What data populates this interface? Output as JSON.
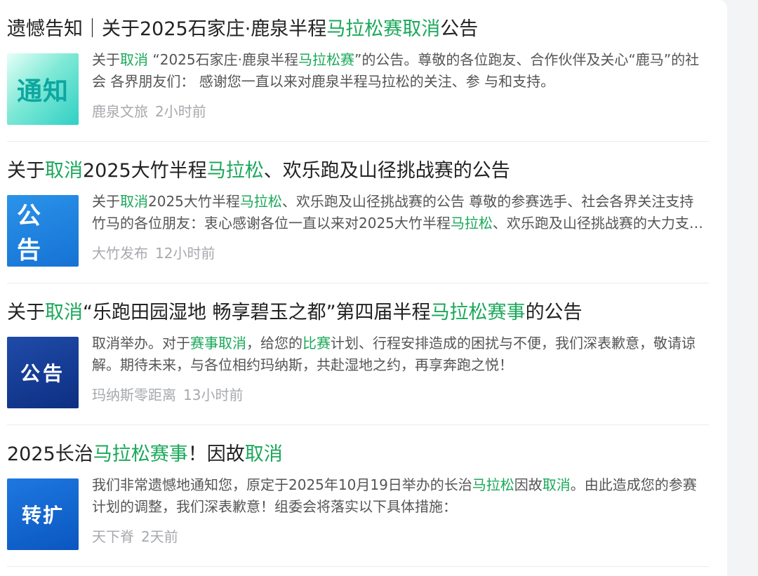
{
  "results": [
    {
      "title": [
        {
          "t": "遗憾告知｜关于2025石家庄·鹿泉半程",
          "hl": false
        },
        {
          "t": "马拉松赛取消",
          "hl": true
        },
        {
          "t": "公告",
          "hl": false
        }
      ],
      "thumb_text": "通知",
      "snippet": [
        {
          "t": "关于",
          "hl": false
        },
        {
          "t": "取消",
          "hl": true
        },
        {
          "t": " “2025石家庄·鹿泉半程",
          "hl": false
        },
        {
          "t": "马拉松赛",
          "hl": true
        },
        {
          "t": "”的公告。尊敬的各位跑友、合作伙伴及关心“鹿马”的社会 各界朋友们： 感谢您一直以来对鹿泉半程马拉松的关注、参 与和支持。",
          "hl": false
        }
      ],
      "source": "鹿泉文旅",
      "time": "2小时前"
    },
    {
      "title": [
        {
          "t": "关于",
          "hl": false
        },
        {
          "t": "取消",
          "hl": true
        },
        {
          "t": "2025大竹半程",
          "hl": false
        },
        {
          "t": "马拉松",
          "hl": true
        },
        {
          "t": "、欢乐跑及山径挑战赛的公告",
          "hl": false
        }
      ],
      "thumb_text": "公告",
      "snippet": [
        {
          "t": "关于",
          "hl": false
        },
        {
          "t": "取消",
          "hl": true
        },
        {
          "t": "2025大竹半程",
          "hl": false
        },
        {
          "t": "马拉松",
          "hl": true
        },
        {
          "t": "、欢乐跑及山径挑战赛的公告 尊敬的参赛选手、社会各界关注支持竹马的各位朋友：衷心感谢各位一直以来对2025大竹半程",
          "hl": false
        },
        {
          "t": "马拉松",
          "hl": true
        },
        {
          "t": "、欢乐跑及山径挑战赛的大力支持！",
          "hl": false
        }
      ],
      "source": "大竹发布",
      "time": "12小时前"
    },
    {
      "title": [
        {
          "t": "关于",
          "hl": false
        },
        {
          "t": "取消",
          "hl": true
        },
        {
          "t": "“乐跑田园湿地 畅享碧玉之都”第四届半程",
          "hl": false
        },
        {
          "t": "马拉松赛事",
          "hl": true
        },
        {
          "t": "的公告",
          "hl": false
        }
      ],
      "thumb_text": "公告",
      "snippet": [
        {
          "t": "取消举办。对于",
          "hl": false
        },
        {
          "t": "赛事取消",
          "hl": true
        },
        {
          "t": "，给您的",
          "hl": false
        },
        {
          "t": "比赛",
          "hl": true
        },
        {
          "t": "计划、行程安排造成的困扰与不便，我们深表歉意，敬请谅解。期待未来，与各位相约玛纳斯，共赴湿地之约，再享奔跑之悦！",
          "hl": false
        }
      ],
      "source": "玛纳斯零距离",
      "time": "13小时前"
    },
    {
      "title": [
        {
          "t": "2025长治",
          "hl": false
        },
        {
          "t": "马拉松赛事",
          "hl": true
        },
        {
          "t": "！因故",
          "hl": false
        },
        {
          "t": "取消",
          "hl": true
        }
      ],
      "thumb_text": "转扩",
      "snippet": [
        {
          "t": "我们非常遗憾地通知您，原定于2025年10月19日举办的长治",
          "hl": false
        },
        {
          "t": "马拉松",
          "hl": true
        },
        {
          "t": "因故",
          "hl": false
        },
        {
          "t": "取消",
          "hl": true
        },
        {
          "t": "。由此造成您的参赛计划的调整，我们深表歉意！组委会将落实以下具体措施：",
          "hl": false
        }
      ],
      "source": "天下脊",
      "time": "2天前"
    }
  ],
  "colors": {
    "highlight": "#1aa85a",
    "title": "#222222",
    "snippet": "#555555",
    "meta": "#a7a9ad"
  }
}
